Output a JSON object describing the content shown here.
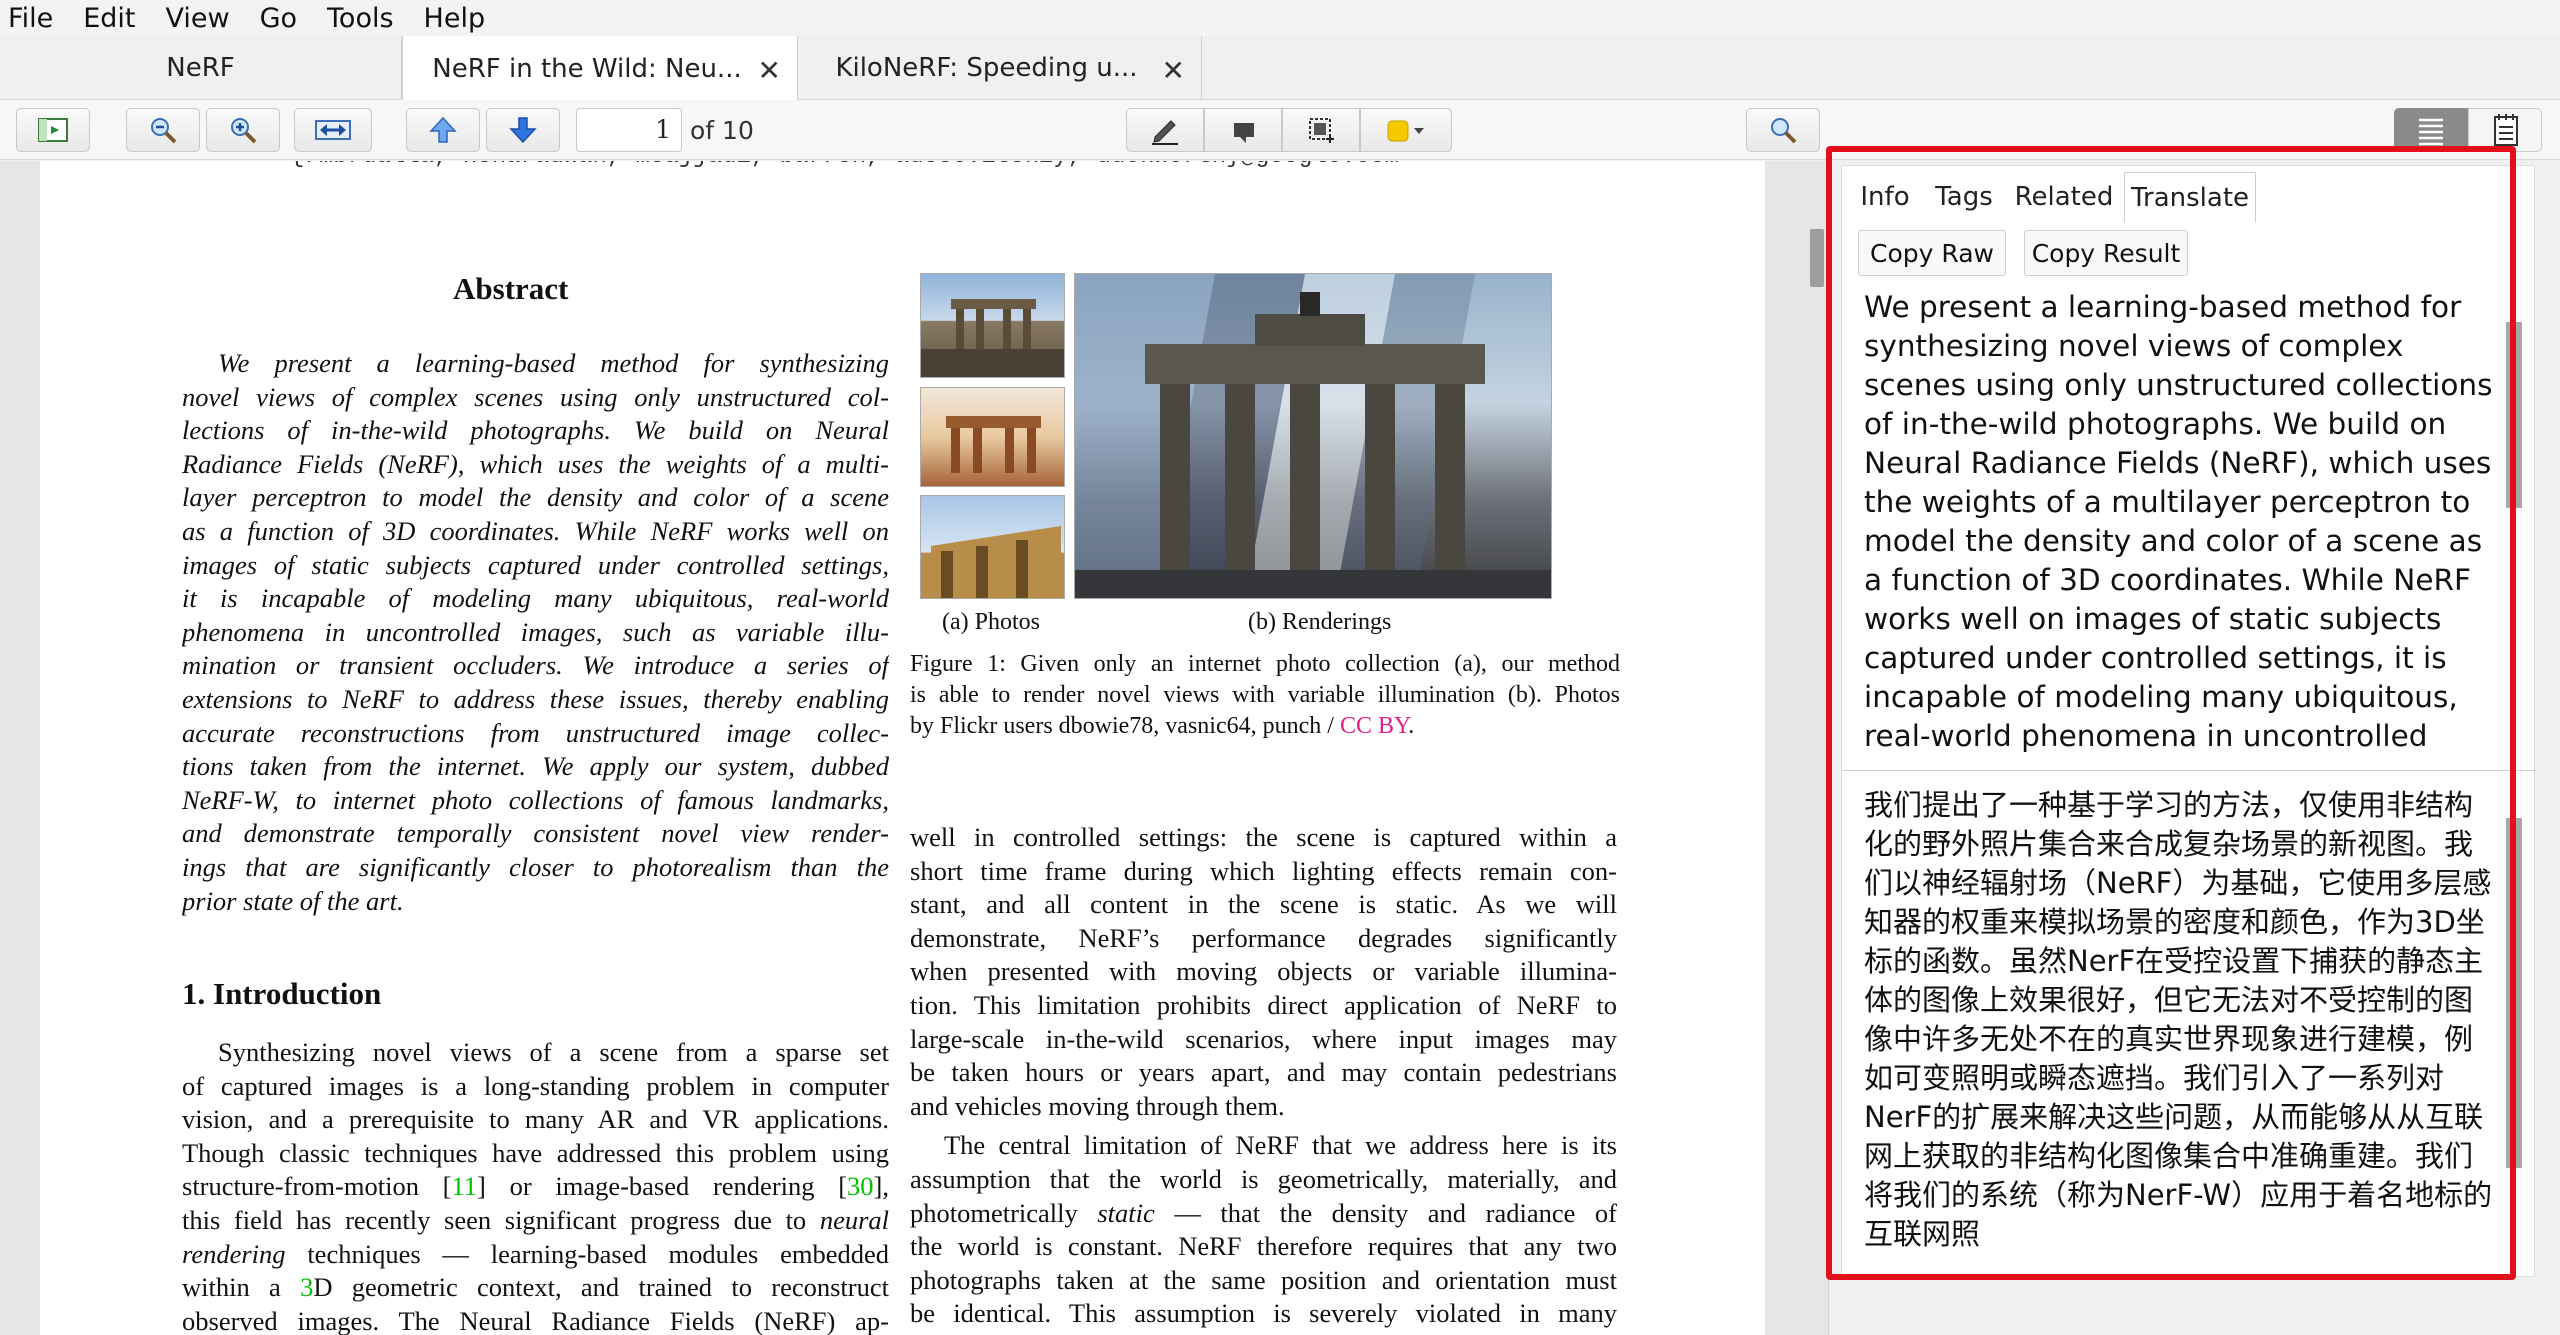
{
  "menu": [
    "File",
    "Edit",
    "View",
    "Go",
    "Tools",
    "Help"
  ],
  "tabs": [
    {
      "label": "NeRF",
      "active": false
    },
    {
      "label": "NeRF in the Wild: Neu...",
      "active": true
    },
    {
      "label": "KiloNeRF: Speeding u...",
      "active": false
    }
  ],
  "toolbar": {
    "page_current": "1",
    "page_total_label": "of 10",
    "highlight_color": "#f5c800"
  },
  "document": {
    "emails": "{rmbrualla, noharadwan, msajjadi, barron, adosovitskiy, duckworth}@google.com",
    "abstract_title": "Abstract",
    "abstract_lines": [
      "We present a learning-based method for synthesizing",
      "novel views of complex scenes using only unstructured col-",
      "lections of in-the-wild photographs.  We build on Neural",
      "Radiance Fields (NeRF), which uses the weights of a multi-",
      "layer perceptron to model the density and color of a scene",
      "as a function of 3D coordinates. While NeRF works well on",
      "images of static subjects captured under controlled settings,",
      "it is incapable of modeling many ubiquitous, real-world",
      "phenomena in uncontrolled images, such as variable illu-",
      "mination or transient occluders.  We introduce a series of",
      "extensions to NeRF to address these issues, thereby enabling",
      "accurate reconstructions from unstructured image collec-",
      "tions taken from the internet. We apply our system, dubbed",
      "NeRF-W, to internet photo collections of famous landmarks,",
      "and demonstrate temporally consistent novel view render-",
      "ings that are significantly closer to photorealism than the",
      "prior state of the art."
    ],
    "intro_title": "1. Introduction",
    "intro_lines": [
      "Synthesizing novel views of a scene from a sparse set",
      "of captured images is a long-standing problem in computer",
      "vision, and a prerequisite to many AR and VR applications.",
      "Though classic techniques have addressed this problem using",
      "structure-from-motion [11] or image-based rendering [30],",
      "this field has recently seen significant progress due to neural",
      "rendering techniques — learning-based modules embedded",
      "within a 3D geometric context, and trained to reconstruct",
      "observed images. The Neural Radiance Fields (NeRF) ap-"
    ],
    "figure_label_a": "(a) Photos",
    "figure_label_b": "(b) Renderings",
    "figure_caption_lines": [
      "Figure 1: Given only an internet photo collection (a), our method",
      "is able to render novel views with variable illumination (b). Photos",
      "by Flickr users dbowie78, vasnic64, punch / CC BY."
    ],
    "right_col_lines": [
      "well in controlled settings: the scene is captured within a",
      "short time frame during which lighting effects remain con-",
      "stant, and all content in the scene is static.  As we will",
      "demonstrate, NeRF’s performance degrades significantly",
      "when presented with moving objects or variable illumina-",
      "tion. This limitation prohibits direct application of NeRF to",
      "large-scale in-the-wild scenarios, where input images may",
      "be taken hours or years apart, and may contain pedestrians",
      "and vehicles moving through them.",
      "The central limitation of NeRF that we address here is its",
      "assumption that the world is geometrically, materially, and",
      "photometrically static — that the density and radiance of",
      "the world is constant. NeRF therefore requires that any two",
      "photographs taken at the same position and orientation must",
      "be identical. This assumption is severely violated in many"
    ]
  },
  "panel": {
    "tabs": [
      "Info",
      "Tags",
      "Related",
      "Translate"
    ],
    "active_tab": "Translate",
    "copy_raw": "Copy Raw",
    "copy_result": "Copy Result",
    "raw_text": "We present a learning-based method for synthesizing novel views of complex scenes using only unstructured collections of in-the-wild photographs. We build on Neural Radiance Fields (NeRF), which uses the weights of a multilayer perceptron to model the density and color of a scene as a function of 3D coordinates. While NeRF works well on images of static subjects captured under controlled settings, it is incapable of modeling many ubiquitous, real-world phenomena in uncontrolled",
    "result_text": "我们提出了一种基于学习的方法，仅使用非结构化的野外照片集合来合成复杂场景的新视图。我们以神经辐射场（NeRF）为基础，它使用多层感知器的权重来模拟场景的密度和颜色，作为3D坐标的函数。虽然NerF在受控设置下捕获的静态主体的图像上效果很好，但它无法对不受控制的图像中许多无处不在的真实世界现象进行建模，例如可变照明或瞬态遮挡。我们引入了一系列对NerF的扩展来解决这些问题，从而能够从从互联网上获取的非结构化图像集合中准确重建。我们将我们的系统（称为NerF-W）应用于着名地标的互联网照",
    "highlight_color": "#e3101b"
  }
}
